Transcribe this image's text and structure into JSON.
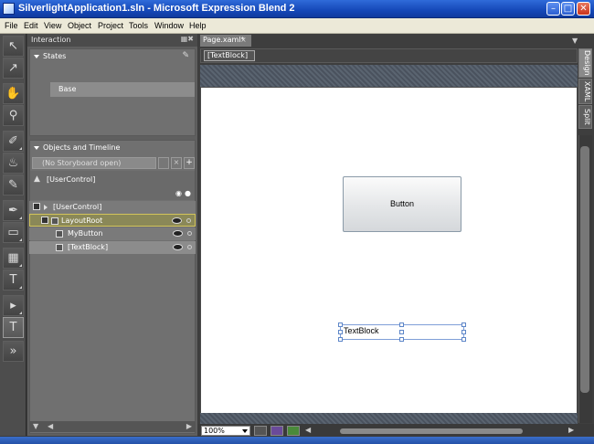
{
  "window": {
    "title": "SilverlightApplication1.sln - Microsoft Expression Blend 2"
  },
  "menu": [
    "File",
    "Edit",
    "View",
    "Object",
    "Project",
    "Tools",
    "Window",
    "Help"
  ],
  "interaction": {
    "panel_title": "Interaction",
    "states_label": "States",
    "base_state": "Base",
    "objects_label": "Objects and Timeline",
    "storyboard_placeholder": "(No Storyboard open)",
    "scope": "[UserControl]",
    "tree": [
      {
        "label": "[UserControl]",
        "level": 0
      },
      {
        "label": "LayoutRoot",
        "level": 1,
        "selected": true
      },
      {
        "label": "MyButton",
        "level": 2
      },
      {
        "label": "[TextBlock]",
        "level": 2
      }
    ]
  },
  "document": {
    "tab": "Page.xaml*",
    "breadcrumb": "[TextBlock]",
    "view_tabs": [
      "Design",
      "XAML",
      "Split"
    ],
    "button_text": "Button",
    "textblock_text": "TextBlock",
    "zoom": "100%"
  },
  "colors": {
    "titlebar": "#1548b8",
    "panel": "#5f5f5f",
    "artboard": "#ffffff",
    "selection": "#d2c45a"
  }
}
